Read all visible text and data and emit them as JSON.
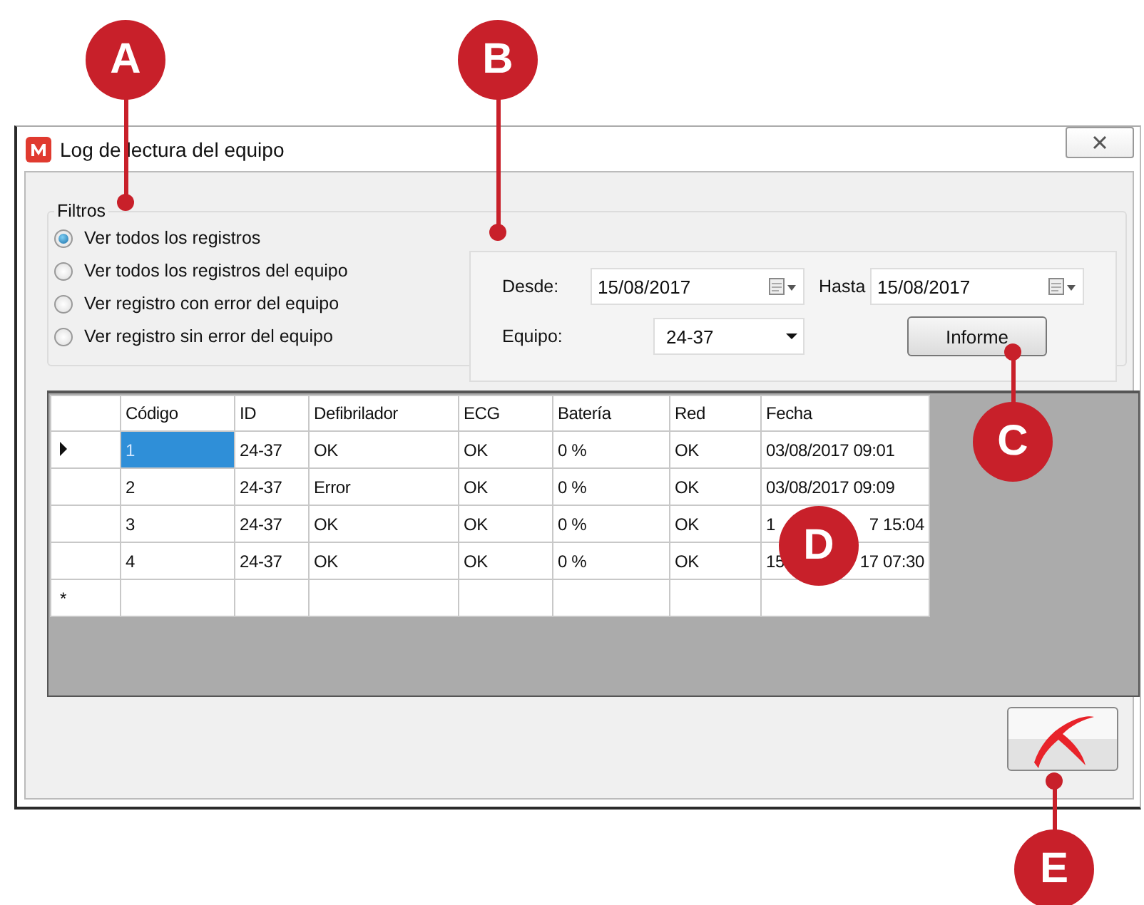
{
  "window": {
    "title": "Log de lectura del equipo"
  },
  "filters": {
    "label": "Filtros",
    "options": [
      {
        "label": "Ver todos los registros",
        "selected": true
      },
      {
        "label": "Ver todos los registros del equipo",
        "selected": false
      },
      {
        "label": "Ver registro con error del equipo",
        "selected": false
      },
      {
        "label": "Ver registro sin error del equipo",
        "selected": false
      }
    ]
  },
  "range": {
    "desde_label": "Desde:",
    "desde_value": "15/08/2017",
    "hasta_label": "Hasta",
    "hasta_value": "15/08/2017",
    "equipo_label": "Equipo:",
    "equipo_value": "24-37",
    "report_button": "Informe"
  },
  "table": {
    "columns": [
      "Código",
      "ID",
      "Defibrilador",
      "ECG",
      "Batería",
      "Red",
      "Fecha"
    ],
    "rows": [
      {
        "selected": true,
        "cells": [
          "1",
          "24-37",
          "OK",
          "OK",
          "0 %",
          "OK",
          [
            "03/08/2017 09:01"
          ]
        ]
      },
      {
        "selected": false,
        "cells": [
          "2",
          "24-37",
          "Error",
          "OK",
          "0 %",
          "OK",
          [
            "03/08/2017 09:09"
          ]
        ]
      },
      {
        "selected": false,
        "cells": [
          "3",
          "24-37",
          "OK",
          "OK",
          "0 %",
          "OK",
          [
            "1",
            "7 15:04"
          ]
        ]
      },
      {
        "selected": false,
        "cells": [
          "4",
          "24-37",
          "OK",
          "OK",
          "0 %",
          "OK",
          [
            "15",
            "17 07:30"
          ]
        ]
      }
    ],
    "new_row_marker": "*"
  },
  "callouts": [
    "A",
    "B",
    "C",
    "D",
    "E"
  ]
}
